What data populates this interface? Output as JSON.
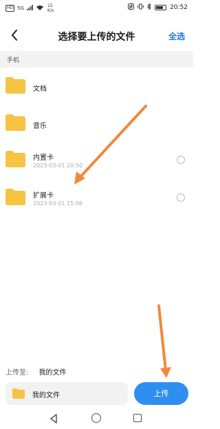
{
  "status_bar": {
    "network": "HD",
    "signal": "5G",
    "speed_value": "15",
    "speed_unit": "K/s",
    "time": "20:52"
  },
  "header": {
    "back_icon": "chevron-left-icon",
    "title": "选择要上传的文件",
    "select_all": "全选"
  },
  "section": {
    "label": "手机"
  },
  "folders": [
    {
      "name": "文档",
      "date": "",
      "selectable": false
    },
    {
      "name": "音乐",
      "date": "",
      "selectable": false
    },
    {
      "name": "内置卡",
      "date": "2023-03-01 20:50",
      "selectable": true
    },
    {
      "name": "扩展卡",
      "date": "2023-03-01 15:06",
      "selectable": true
    }
  ],
  "footer": {
    "upload_to_label": "上传至:",
    "upload_to_value": "我的文件",
    "destination_folder": "我的文件",
    "upload_button": "上传"
  },
  "colors": {
    "accent": "#1e76d2",
    "upload_button": "#2f8ff0",
    "folder": "#f6c343",
    "annotation_arrow": "#f0883e"
  }
}
